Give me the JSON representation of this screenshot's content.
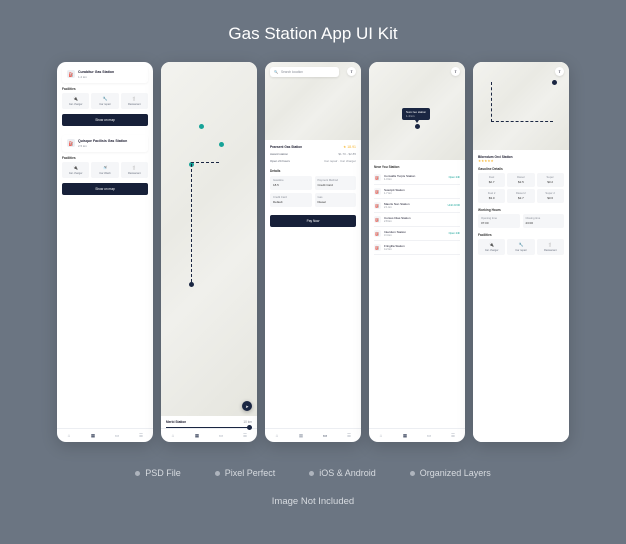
{
  "title": "Gas Station App UI Kit",
  "p1": {
    "s1": {
      "name": "Curabitur Gas Station",
      "dist": "1.2 km",
      "facilities": {
        "label": "Facilities",
        "items": [
          "Car charger",
          "Car repair",
          "Restaurant"
        ]
      },
      "btn": "Show on map"
    },
    "s2": {
      "name": "Quisque Facilisis Gas Station",
      "dist": "2.5 km",
      "facilities": {
        "label": "Facilities",
        "items": [
          "Car charger",
          "Car Wash",
          "Restaurant"
        ]
      },
      "btn": "Show on map"
    }
  },
  "p2": {
    "station": "Merbi Station",
    "dist": "10 km"
  },
  "p3": {
    "search": "Search location",
    "station": "Praesent Gas Station",
    "rating": "18.91",
    "row1": {
      "k": "Award station",
      "v": "$1.70 - $2.85"
    },
    "row2": {
      "k": "Open 24 hours",
      "tags": [
        "Car repair",
        "Car charger"
      ]
    },
    "details": "Details",
    "gal": {
      "label": "Gasoline",
      "val": "18.5"
    },
    "pay": {
      "label": "Payment Method",
      "val": "Credit Card"
    },
    "cards": {
      "a": {
        "l": "Credit Card",
        "v": "Default"
      },
      "b": {
        "l": "Gas",
        "v": "Diesel"
      }
    },
    "btn": "Pay Now"
  },
  "p4": {
    "callout": {
      "name": "Nunc leo station",
      "dist": "1.4 km"
    },
    "section": "Near You Station",
    "items": [
      {
        "name": "Convallis Turpis Station",
        "dist": "1.3 km",
        "right": "Open 24h"
      },
      {
        "name": "Suscipit Station",
        "dist": "1.7 km",
        "right": ""
      },
      {
        "name": "Mauris Non Station",
        "dist": "2.1 km",
        "right": "Until 23:00"
      },
      {
        "name": "Cursus Dias Station",
        "dist": "2.8 km",
        "right": ""
      },
      {
        "name": "Interdum Station",
        "dist": "3.4 km",
        "right": "Open 24h"
      },
      {
        "name": "Fringilla Station",
        "dist": "4.2 km",
        "right": ""
      }
    ]
  },
  "p5": {
    "station": "Bibendum Orci Station",
    "gas": {
      "label": "Gasoline Details",
      "items": [
        {
          "l": "Fuel",
          "v": "$2.7"
        },
        {
          "l": "Diesel",
          "v": "$2.5"
        },
        {
          "l": "Super",
          "v": "$3.2"
        },
        {
          "l": "Fuel 2",
          "v": "$3.0"
        },
        {
          "l": "Diesel 2",
          "v": "$2.7"
        },
        {
          "l": "Super 2",
          "v": "$3.6"
        }
      ]
    },
    "hours": {
      "label": "Working Hours",
      "open": {
        "l": "Opening time",
        "v": "07:00"
      },
      "close": {
        "l": "Closing time",
        "v": "23:00"
      }
    },
    "fac": {
      "label": "Facilities",
      "items": [
        "Car charger",
        "Car repair",
        "Restaurant"
      ]
    }
  },
  "features": [
    "PSD File",
    "Pixel Perfect",
    "iOS & Android",
    "Organized Layers"
  ],
  "note": "Image Not Included"
}
